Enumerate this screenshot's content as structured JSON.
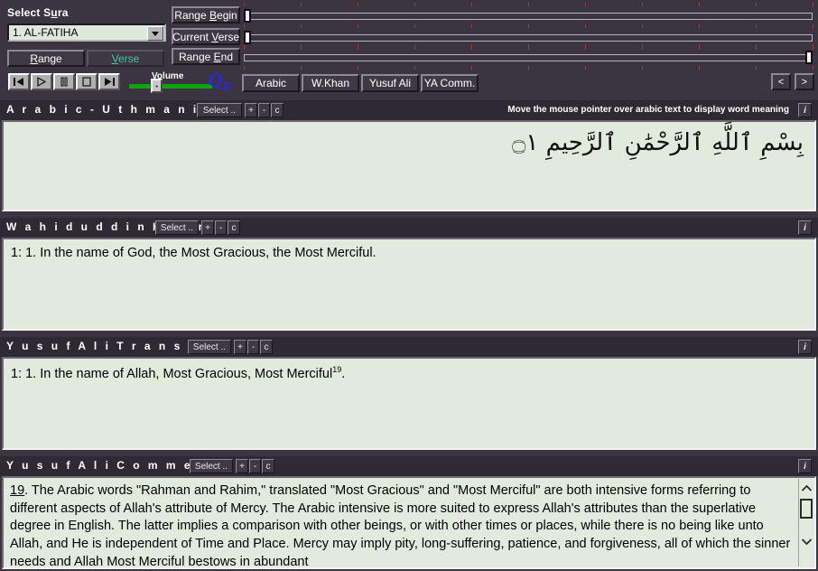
{
  "controls": {
    "select_sura_label": "Select Sura",
    "sura_value": "1. AL-FATIHA",
    "tab_range": "Range",
    "tab_verse": "Verse",
    "volume_label": "Volume",
    "logo": "QR",
    "range_begin_label": "Range Begin",
    "current_verse_label": "Current Verse",
    "range_end_label": "Range End",
    "nav_prev": "<",
    "nav_next": ">",
    "transport": [
      {
        "name": "skip-to-start-button",
        "glyph": "|◀"
      },
      {
        "name": "play-button",
        "glyph": "▶"
      },
      {
        "name": "pause-button",
        "glyph": "||"
      },
      {
        "name": "stop-button",
        "glyph": "■"
      },
      {
        "name": "skip-to-end-button",
        "glyph": "▶|"
      }
    ],
    "sources": [
      {
        "name": "arabic",
        "label": "Arabic"
      },
      {
        "name": "wkhan",
        "label": "W.Khan"
      },
      {
        "name": "yusufali",
        "label": "Yusuf Ali"
      },
      {
        "name": "yacomm",
        "label": "YA Comm."
      }
    ]
  },
  "header_buttons": {
    "select": "Select ..",
    "plus": "+",
    "minus": "-",
    "copy": "c",
    "info": "i"
  },
  "sections": {
    "arabic": {
      "title": "A r a b i c   -   U t h m a n i   s c r i p t",
      "hint": "Move the mouse pointer over arabic text to display word meaning",
      "text": "بِسْمِ ٱللَّهِ ٱلرَّحْمَٰنِ ٱلرَّحِيمِ ۝١"
    },
    "wkhan": {
      "title": "W a h i d u d d i n   K h a n",
      "verse_ref": "1: 1.",
      "verse_text": "In the name of God, the Most Gracious, the Most Merciful."
    },
    "yusufali": {
      "title": "Y u s u f  A l i  T r a n s l a t i o n",
      "verse_ref": "1: 1.",
      "verse_text": "In the name of Allah, Most Gracious, Most Merciful",
      "footnote_marker": "19",
      "verse_tail": "."
    },
    "commentary": {
      "title": "Y u s u f  A l i  C o m m e n t a r y",
      "footnote_number": "19",
      "text": ". The Arabic words \"Rahman and Rahim,\" translated \"Most Gracious\" and \"Most Merciful\" are both intensive forms referring to different aspects of Allah's attribute of Mercy. The Arabic intensive is more suited to express Allah's attributes than the superlative degree in English. The latter implies a comparison with other beings, or with other times or places, while there is no being like unto Allah, and He is independent of Time and Place. Mercy may imply pity, long-suffering, patience, and forgiveness, all of which the sinner needs and Allah Most Merciful bestows in abundant"
    }
  },
  "colors": {
    "window_bg": "#3a3540",
    "panel_bg": "#e2eade",
    "accent_green": "#0aa60a",
    "logo_blue": "#2a2ad0",
    "tick_red": "#9c3b3b",
    "verse_tab_teal": "#4fbfa8"
  }
}
